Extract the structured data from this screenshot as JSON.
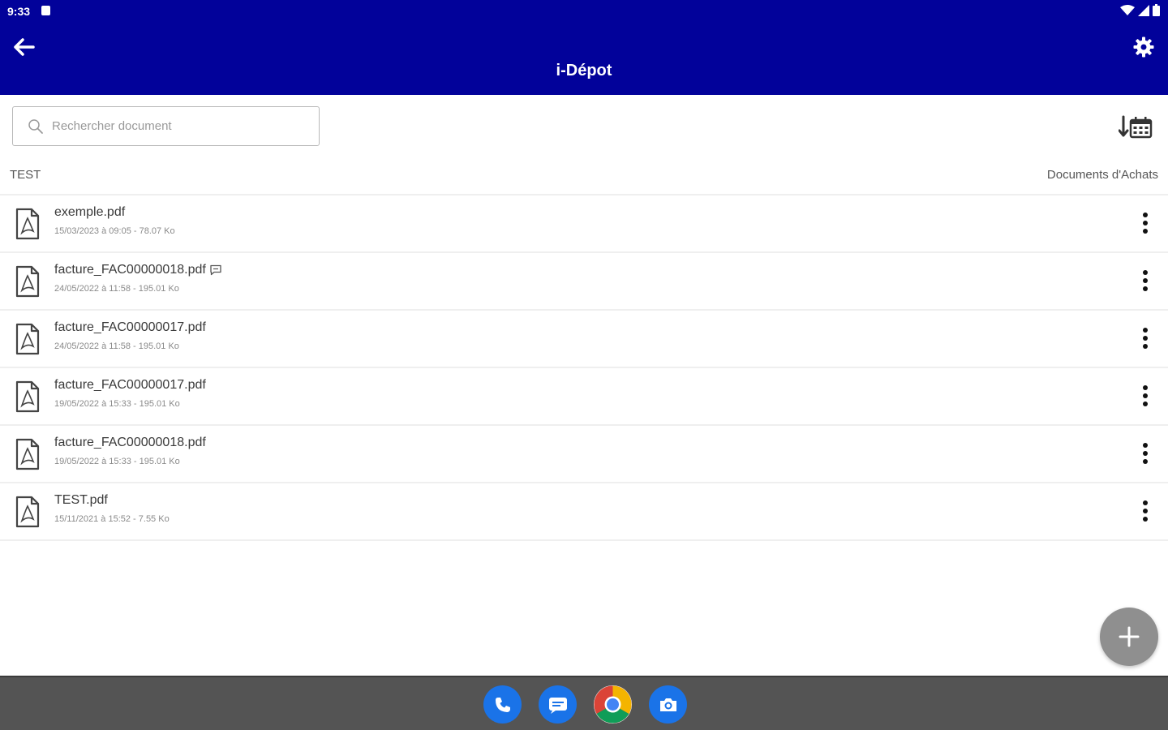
{
  "status_bar": {
    "time": "9:33"
  },
  "app": {
    "title": "i-Dépot"
  },
  "search": {
    "placeholder": "Rechercher document",
    "value": ""
  },
  "section": {
    "left_label": "TEST",
    "right_label": "Documents d'Achats"
  },
  "documents": [
    {
      "name": "exemple.pdf",
      "meta": "15/03/2023 à 09:05 - 78.07 Ko",
      "has_comment": false
    },
    {
      "name": "facture_FAC00000018.pdf",
      "meta": "24/05/2022 à 11:58 - 195.01 Ko",
      "has_comment": true
    },
    {
      "name": "facture_FAC00000017.pdf",
      "meta": "24/05/2022 à 11:58 - 195.01 Ko",
      "has_comment": false
    },
    {
      "name": "facture_FAC00000017.pdf",
      "meta": "19/05/2022 à 15:33 - 195.01 Ko",
      "has_comment": false
    },
    {
      "name": "facture_FAC00000018.pdf",
      "meta": "19/05/2022 à 15:33 - 195.01 Ko",
      "has_comment": false
    },
    {
      "name": "TEST.pdf",
      "meta": "15/11/2021 à 15:52 - 7.55 Ko",
      "has_comment": false
    }
  ],
  "icons": {
    "back": "arrow-left-icon",
    "settings": "gear-icon",
    "search": "search-icon",
    "sort": "sort-by-date-icon",
    "file": "pdf-file-icon",
    "more": "more-vertical-icon",
    "comment": "comment-icon",
    "add": "plus-icon"
  },
  "dock": [
    "phone",
    "messages",
    "chrome",
    "camera"
  ],
  "colors": {
    "primary": "#02029a",
    "fab": "#8f8f8f",
    "navbar": "#545454"
  }
}
